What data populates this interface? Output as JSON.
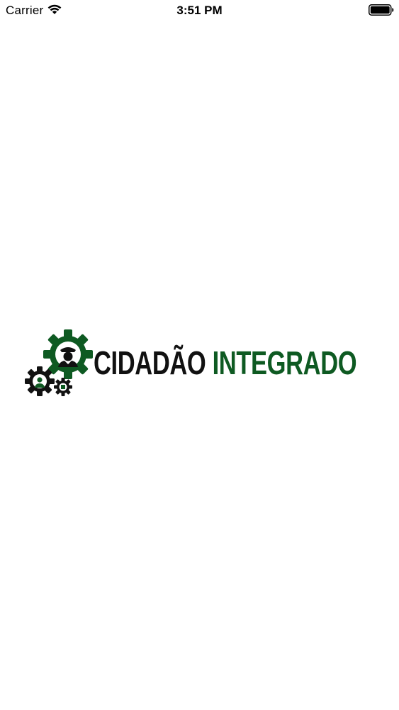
{
  "status_bar": {
    "carrier": "Carrier",
    "time": "3:51 PM",
    "wifi_icon": "wifi-icon",
    "battery_icon": "battery-icon"
  },
  "logo": {
    "word_1": "CIDADÃO",
    "word_2": "INTEGRADO",
    "icon": "gears-with-people-icon",
    "colors": {
      "primary_dark": "#111111",
      "brand_green": "#0e5a22"
    }
  }
}
